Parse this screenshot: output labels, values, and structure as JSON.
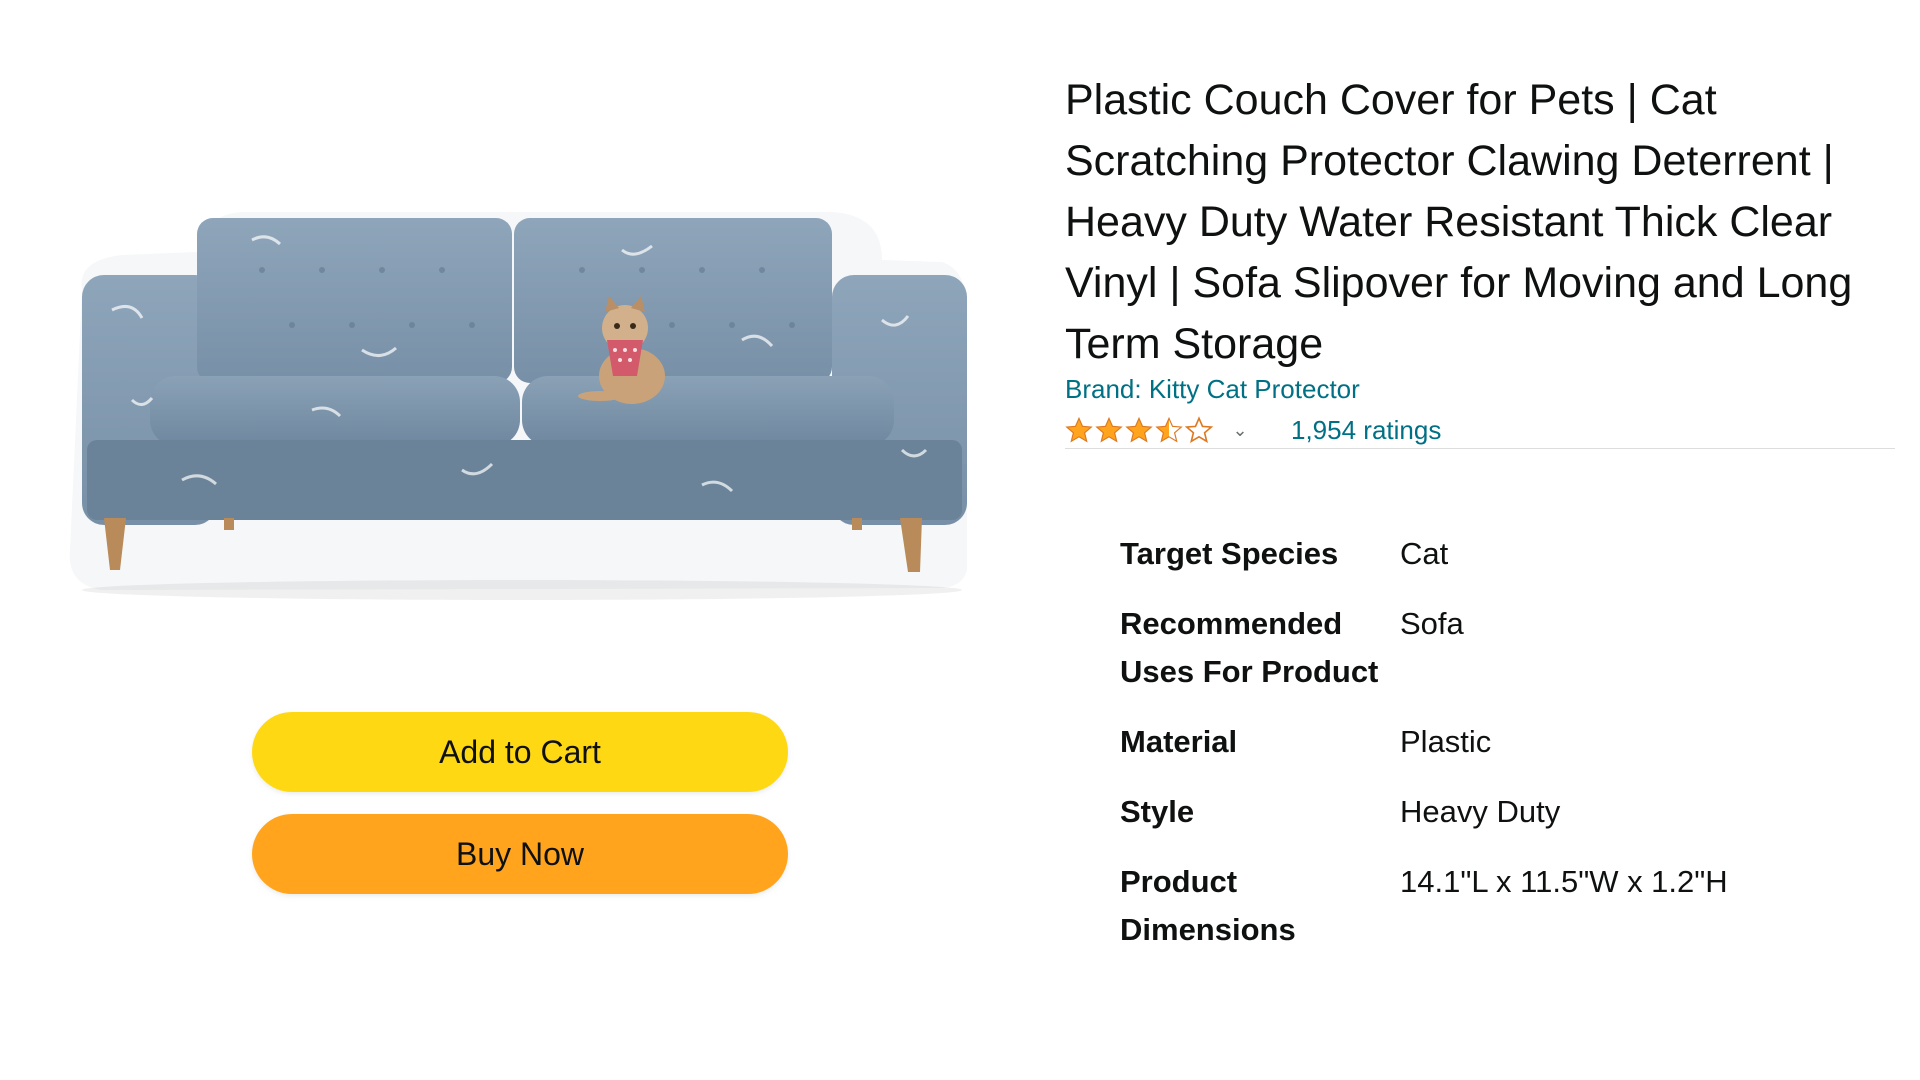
{
  "product": {
    "title": "Plastic Couch Cover for Pets | Cat Scratching Protector Clawing Deterrent | Heavy Duty Water Resistant Thick Clear Vinyl | Sofa Slipover for Moving and Long Term Storage",
    "brand": "Brand: Kitty Cat Protector",
    "rating_value": 3.5,
    "rating_max": 5,
    "ratings_count": "1,954 ratings",
    "image_alt": "sofa-with-cat-in-clear-plastic-cover"
  },
  "actions": {
    "add_to_cart": "Add to Cart",
    "buy_now": "Buy Now"
  },
  "specs": [
    {
      "label": "Target Species",
      "value": "Cat"
    },
    {
      "label": "Recommended Uses For Product",
      "value": "Sofa"
    },
    {
      "label": "Material",
      "value": "Plastic"
    },
    {
      "label": "Style",
      "value": "Heavy Duty"
    },
    {
      "label": "Product Dimensions",
      "value": "14.1\"L x 11.5\"W x 1.2\"H"
    }
  ],
  "colors": {
    "link": "#007185",
    "star": "#ffa41c",
    "add_to_cart_bg": "#ffd814",
    "buy_now_bg": "#ffa41c",
    "sofa": "#7f97ad"
  },
  "icons": {
    "star": "star-icon",
    "dropdown": "chevron-down-icon"
  }
}
